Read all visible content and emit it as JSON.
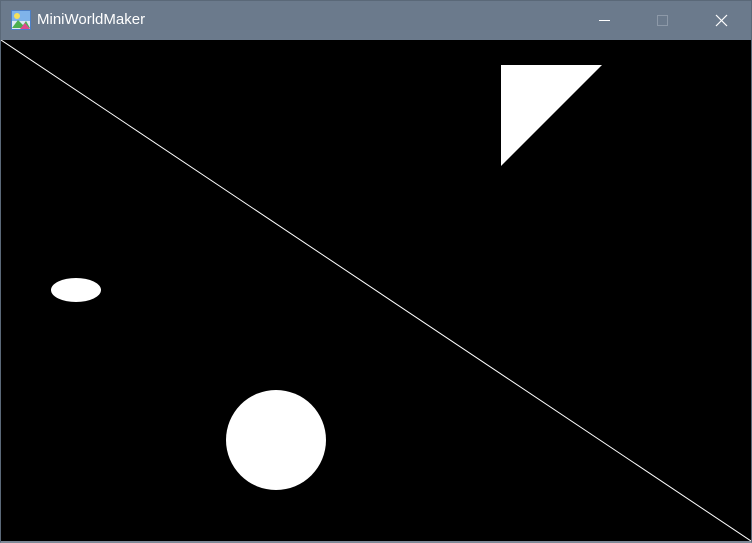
{
  "window": {
    "title": "MiniWorldMaker",
    "controls": {
      "minimize": "minimize-icon",
      "maximize": "maximize-icon",
      "close": "close-icon"
    },
    "colors": {
      "titlebar": "#6b7a8c",
      "title_text": "#ffffff",
      "maximize_disabled": "#8d99a8"
    }
  },
  "canvas": {
    "background": "#000000",
    "shape_color": "#ffffff",
    "shapes": [
      "line",
      "triangle",
      "ellipse",
      "circle"
    ]
  }
}
